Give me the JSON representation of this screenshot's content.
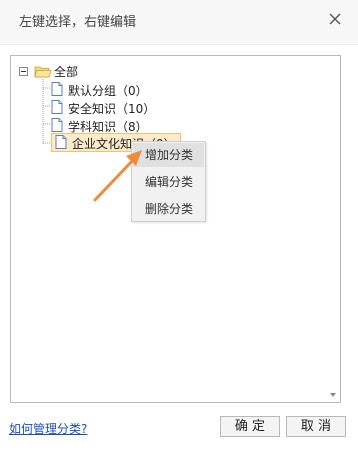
{
  "dialog": {
    "title": "左键选择，右键编辑",
    "close_icon": "close-icon"
  },
  "tree": {
    "root": {
      "label": "全部",
      "expanded": true,
      "icon": "folder-open-icon"
    },
    "items": [
      {
        "label": "默认分组（0）",
        "icon": "document-icon",
        "selected": false
      },
      {
        "label": "安全知识（10）",
        "icon": "document-icon",
        "selected": false
      },
      {
        "label": "学科知识（8）",
        "icon": "document-icon",
        "selected": false
      },
      {
        "label": "企业文化知识（0）",
        "icon": "document-icon",
        "selected": true
      }
    ]
  },
  "context_menu": {
    "items": [
      {
        "label": "增加分类",
        "highlighted": true
      },
      {
        "label": "编辑分类",
        "highlighted": false
      },
      {
        "label": "删除分类",
        "highlighted": false
      }
    ]
  },
  "annotation": {
    "arrow_color": "#f08a3c"
  },
  "footer": {
    "help_link": "如何管理分类?",
    "ok_label": "确 定",
    "cancel_label": "取 消"
  },
  "colors": {
    "selection_bg": "#fbebcb",
    "selection_border": "#f0c26a",
    "link": "#1a4fb4",
    "folder": "#f3c85a"
  }
}
